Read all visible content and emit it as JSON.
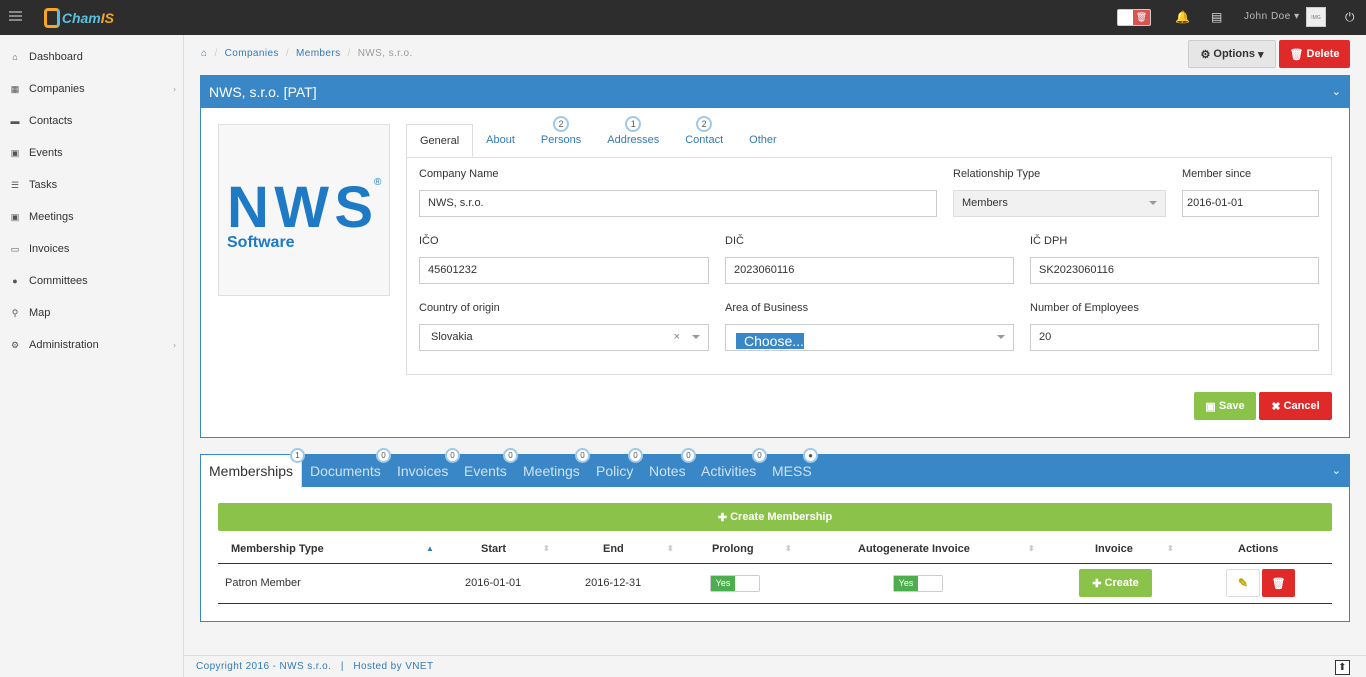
{
  "app": {
    "logo_text_a": "Cham",
    "logo_text_b": "IS"
  },
  "topbar": {
    "user_name": "John Doe",
    "avatar_text": "IMG"
  },
  "sidebar": {
    "items": [
      {
        "label": "Dashboard",
        "icon": "home-icon"
      },
      {
        "label": "Companies",
        "icon": "building-icon",
        "expandable": true
      },
      {
        "label": "Contacts",
        "icon": "book-icon"
      },
      {
        "label": "Events",
        "icon": "calendar-icon"
      },
      {
        "label": "Tasks",
        "icon": "tasks-icon"
      },
      {
        "label": "Meetings",
        "icon": "calendar-icon"
      },
      {
        "label": "Invoices",
        "icon": "money-icon"
      },
      {
        "label": "Committees",
        "icon": "users-icon"
      },
      {
        "label": "Map",
        "icon": "map-marker-icon"
      },
      {
        "label": "Administration",
        "icon": "cogs-icon",
        "expandable": true
      }
    ]
  },
  "breadcrumb": {
    "home_icon": "home-icon",
    "items": [
      "Companies",
      "Members",
      "NWS, s.r.o."
    ]
  },
  "header_actions": {
    "options_label": "Options",
    "delete_label": "Delete"
  },
  "company": {
    "title": "NWS, s.r.o. [PAT]",
    "logo_text": "NWS",
    "logo_sub": "Software",
    "tabs": [
      {
        "label": "General",
        "active": true
      },
      {
        "label": "About"
      },
      {
        "label": "Persons",
        "badge": "2"
      },
      {
        "label": "Addresses",
        "badge": "1"
      },
      {
        "label": "Contact",
        "badge": "2"
      },
      {
        "label": "Other"
      }
    ],
    "fields": {
      "company_name": {
        "label": "Company Name",
        "value": "NWS, s.r.o."
      },
      "relationship_type": {
        "label": "Relationship Type",
        "value": "Members"
      },
      "member_since": {
        "label": "Member since",
        "value": "2016-01-01"
      },
      "ico": {
        "label": "IČO",
        "value": "45601232"
      },
      "dic": {
        "label": "DIČ",
        "value": "2023060116"
      },
      "ic_dph": {
        "label": "IČ DPH",
        "value": "SK2023060116"
      },
      "country": {
        "label": "Country of origin",
        "value": "Slovakia"
      },
      "area": {
        "label": "Area of Business",
        "placeholder": "Choose..."
      },
      "employees": {
        "label": "Number of Employees",
        "value": "20"
      }
    },
    "save_label": "Save",
    "cancel_label": "Cancel"
  },
  "bottom": {
    "tabs": [
      {
        "label": "Memberships",
        "badge": "1",
        "active": true
      },
      {
        "label": "Documents",
        "badge": "0"
      },
      {
        "label": "Invoices",
        "badge": "0"
      },
      {
        "label": "Events",
        "badge": "0"
      },
      {
        "label": "Meetings",
        "badge": "0"
      },
      {
        "label": "Policy",
        "badge": "0"
      },
      {
        "label": "Notes",
        "badge": "0"
      },
      {
        "label": "Activities",
        "badge": "0"
      },
      {
        "label": "MESS",
        "badge": "●"
      }
    ],
    "create_membership_label": "Create Membership",
    "table": {
      "headers": [
        "Membership Type",
        "Start",
        "End",
        "Prolong",
        "Autogenerate Invoice",
        "Invoice",
        "Actions"
      ],
      "rows": [
        {
          "type": "Patron Member",
          "start": "2016-01-01",
          "end": "2016-12-31",
          "prolong": "Yes",
          "autogenerate": "Yes",
          "invoice_button": "Create"
        }
      ]
    }
  },
  "footer": {
    "copyright": "Copyright 2016 - NWS s.r.o.",
    "separator": "|",
    "hosted": "Hosted by VNET"
  },
  "colors": {
    "primary": "#3a87c8",
    "success": "#8bc34a",
    "danger": "#e02a2a"
  }
}
